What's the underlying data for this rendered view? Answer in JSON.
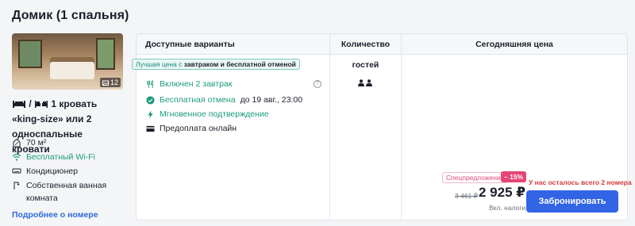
{
  "room": {
    "title": "Домик (1 спальня)",
    "photo_count": "12",
    "beds_suffix": "1 кровать «king-size» или 2 односпальные кровати",
    "amenities": [
      {
        "icon": "area-icon",
        "label": "70 м²"
      },
      {
        "icon": "wifi-icon",
        "label": "Бесплатный Wi-Fi"
      },
      {
        "icon": "air-conditioner-icon",
        "label": "Кондиционер"
      },
      {
        "icon": "shower-icon",
        "label": "Собственная ванная комната"
      }
    ],
    "more_link": "Подробнее о номере"
  },
  "table": {
    "headers": {
      "options": "Доступные варианты",
      "guests": "Количество гостей",
      "price": "Сегодняшняя цена"
    },
    "badge": {
      "prefix": "Лучшая цена с ",
      "highlight": "завтраком и бесплатной отменой"
    },
    "features": {
      "breakfast": "Включен 2 завтрак",
      "cancel": "Бесплатная отмена",
      "cancel_date": "до 19 авг., 23:00",
      "instant": "Мгновенное подтверждение",
      "prepay": "Предоплата онлайн"
    },
    "price_block": {
      "special_label": "Спецпредложение",
      "discount": "– 15%",
      "rooms_left": "У нас осталось всего 2 номера",
      "old_price": "3 461 ₽",
      "price": "2 925 ₽",
      "taxes": "Вкл. налоги",
      "book_label": "Забронировать"
    }
  },
  "colors": {
    "accent_blue": "#3264e6",
    "green": "#1a9a7a",
    "pink": "#e64576",
    "red": "#d6383a"
  }
}
